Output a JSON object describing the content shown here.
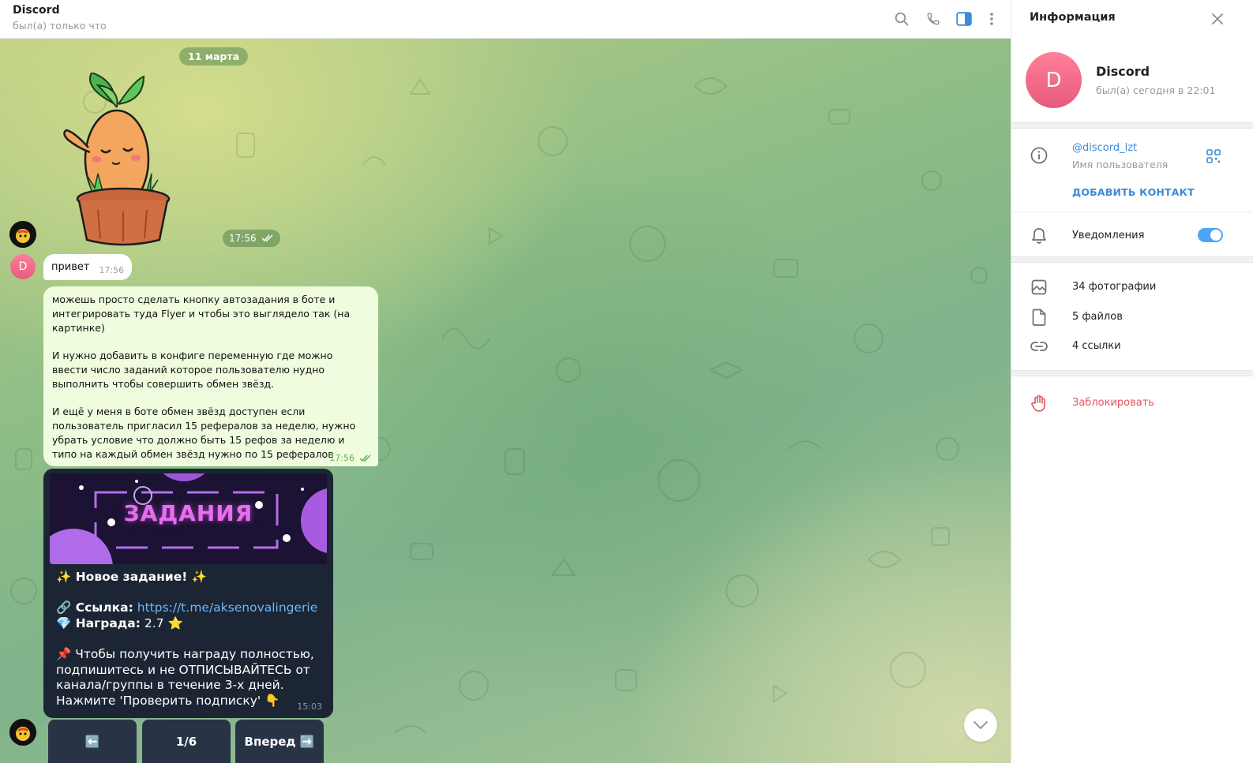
{
  "chat_header": {
    "title": "Discord",
    "status": "был(а) только что",
    "icons": [
      "search-icon",
      "phone-icon",
      "sidebar-toggle-icon",
      "more-vert-icon"
    ]
  },
  "date_pill": "11 марта",
  "sticker": {
    "time": "17:56"
  },
  "messages": {
    "greeting": {
      "text": "привет",
      "time": "17:56"
    },
    "outgoing": {
      "paragraphs": [
        "можешь просто сделать кнопку автозадания в боте и интегрировать туда Flyer и чтобы это выглядело так (на картинке)",
        "И нужно добавить в конфиге переменную где можно ввести число заданий которое пользователю нудно выполнить чтобы совершить обмен звёзд.",
        "И ещё у меня в боте обмен звёзд доступен если пользователь пригласил 15 рефералов за неделю, нужно убрать условие что должно быть 15 рефов за неделю и типо на каждый обмен звёзд нужно по 15 рефералов"
      ],
      "time": "17:56"
    },
    "bot": {
      "banner_title": "ЗАДАНИЯ",
      "line_new_task": "✨ Новое задание! ✨",
      "link_label": "🔗 Ссылка:",
      "link_url": "https://t.me/aksenovalingerie",
      "reward_label": "💎 Награда:",
      "reward_value": "2.7 ⭐",
      "instruction": "📌 Чтобы получить награду полностью, подпишитесь и не ОТПИСЫВАЙТЕСЬ от канала/группы в течение 3-х дней. Нажмите 'Проверить подписку' 👇",
      "time": "15:03",
      "keyboard": {
        "back": "⬅️",
        "page": "1/6",
        "forward": "Вперед ➡️"
      }
    }
  },
  "avatar_letter": "D",
  "info_panel": {
    "title": "Информация",
    "name": "Discord",
    "last_seen": "был(а) сегодня в 22:01",
    "username": "@discord_lzt",
    "username_label": "Имя пользователя",
    "add_contact": "ДОБАВИТЬ КОНТАКТ",
    "notifications": "Уведомления",
    "notifications_on": true,
    "photos": "34 фотографии",
    "files": "5 файлов",
    "links": "4 ссылки",
    "block": "Заблокировать"
  },
  "colors": {
    "accent": "#3a8bd8",
    "outgoing_bubble": "#effdde",
    "bot_bubble": "#1b2533",
    "danger": "#e5545e",
    "avatar": "#ee6b88"
  }
}
